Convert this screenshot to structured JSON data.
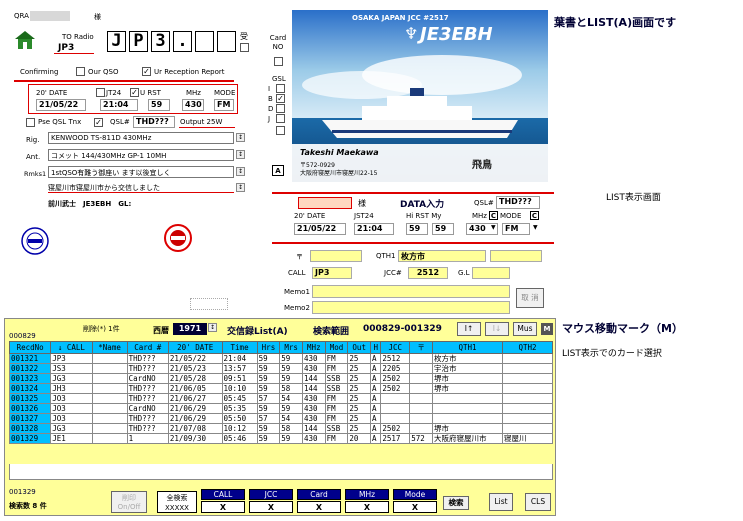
{
  "card": {
    "qra_label": "QRA",
    "qra_value": "",
    "sama": "様",
    "to_radio": "TO Radio",
    "to_call": "JP3",
    "call_chars": [
      "J",
      "P",
      "3",
      ".",
      "",
      ""
    ],
    "uke": "受",
    "card_no_label": "Card NO",
    "confirming": "Confirming",
    "our_qso": "Our QSO",
    "ur_reception": "Ur Reception Report",
    "headers": [
      "20' DATE",
      "JT24",
      "U RST",
      "MHz",
      "MODE"
    ],
    "date": "21/05/22",
    "time": "21:04",
    "rst": "59",
    "mhz": "430",
    "mode": "FM",
    "pse_qsl": "Pse QSL Tnx",
    "qsl_hash": "QSL#",
    "qsl_value": "THD???",
    "output": "Output 25W",
    "rig_label": "Rig.",
    "rig_value": "KENWOOD TS-811D 430MHz",
    "ant_label": "Ant.",
    "ant_value": "コメット 144/430MHz GP-1 10MH",
    "rmks_label": "Rmks1",
    "rmks_value": "1stQSO有難う御座い ます以後宜しく",
    "remark2": "寝屋川市寝屋川市から交信しました",
    "signature": "前川武士　JE3EBH　GL:",
    "gsl_label": "GSL",
    "gsl_options": [
      "I",
      "B",
      "D",
      "J"
    ],
    "gsl_checked": [
      false,
      true,
      false,
      false
    ],
    "a_box": "A"
  },
  "qsl_image": {
    "top_text": "OSAKA JAPAN  JCC #2517",
    "callsign": "JE3EBH",
    "name": "Takeshi Maekawa",
    "addr1": "〒572-0929",
    "addr2": "大阪府寝屋川市寝屋川22-15",
    "ship_name": "飛鳥"
  },
  "annotations": {
    "title1": "葉書とLIST(A)画面です",
    "list_view": "LIST表示画面",
    "mouse_mark": "マウス移動マーク（M）",
    "card_select": "LIST表示でのカード選択"
  },
  "data_entry": {
    "sama": "様",
    "title": "DATA入力",
    "qsl_label": "QSL#",
    "qsl_value": "THD???",
    "headers": [
      "20' DATE",
      "JST24",
      "Hi RST My",
      "MHz",
      "MODE"
    ],
    "date": "21/05/22",
    "time": "21:04",
    "rst": "59",
    "rst_my": "59",
    "mhz": "430",
    "mode": "FM",
    "c_label": "C",
    "zip_label": "〒",
    "qth_label": "QTH1",
    "qth_value": "枚方市",
    "call_label": "CALL",
    "call_value": "JP3",
    "jcc_label": "JCC#",
    "jcc_value": "2512",
    "gl_label": "G.L",
    "memo1_label": "Memo1",
    "memo2_label": "Memo2",
    "delete_label": "取 消"
  },
  "list": {
    "count_top": "000829",
    "deleted": "削除(*) 1件",
    "era": "西暦",
    "year": "1971",
    "title": "交信録List(A)",
    "range_label": "検索範囲",
    "range_value": "000829-001329",
    "btn_up": "I↑",
    "btn_down": "I↓",
    "btn_mus": "Mus",
    "btn_m": "M",
    "columns": [
      "RecdNo",
      "↓ CALL",
      "*Name",
      "Card #",
      "20' DATE",
      "Time",
      "Hrs",
      "Mrs",
      "MHz",
      "Mod",
      "Out",
      "H",
      "JCC",
      "〒",
      "QTH1",
      "QTH2"
    ],
    "rows": [
      [
        "001321",
        "JP3",
        "",
        "THD???",
        "21/05/22",
        "21:04",
        "59",
        "59",
        "430",
        "FM",
        "25",
        "A",
        "2512",
        "",
        "枚方市",
        ""
      ],
      [
        "001322",
        "JS3",
        "",
        "THD???",
        "21/05/23",
        "13:57",
        "59",
        "59",
        "430",
        "FM",
        "25",
        "A",
        "2205",
        "",
        "宇治市",
        ""
      ],
      [
        "001323",
        "JG3",
        "",
        "CardNO",
        "21/05/28",
        "09:51",
        "59",
        "59",
        "144",
        "SSB",
        "25",
        "A",
        "2502",
        "",
        "堺市",
        ""
      ],
      [
        "001324",
        "JH3",
        "",
        "THD???",
        "21/06/05",
        "10:10",
        "59",
        "58",
        "144",
        "SSB",
        "25",
        "A",
        "2502",
        "",
        "堺市",
        ""
      ],
      [
        "001325",
        "JO3",
        "",
        "THD???",
        "21/06/27",
        "05:45",
        "57",
        "54",
        "430",
        "FM",
        "25",
        "A",
        "",
        "",
        "",
        ""
      ],
      [
        "001326",
        "JO3",
        "",
        "CardNO",
        "21/06/29",
        "05:35",
        "59",
        "59",
        "430",
        "FM",
        "25",
        "A",
        "",
        "",
        "",
        ""
      ],
      [
        "001327",
        "JO3",
        "",
        "THD???",
        "21/06/29",
        "05:50",
        "57",
        "54",
        "430",
        "FM",
        "25",
        "A",
        "",
        "",
        "",
        ""
      ],
      [
        "001328",
        "JG3",
        "",
        "THD???",
        "21/07/08",
        "10:12",
        "59",
        "58",
        "144",
        "SSB",
        "25",
        "A",
        "2502",
        "",
        "堺市",
        ""
      ],
      [
        "001329",
        "JE1",
        "",
        "1",
        "21/09/30",
        "05:46",
        "59",
        "59",
        "430",
        "FM",
        "20",
        "A",
        "2517",
        "572",
        "大阪府寝屋川市",
        "寝屋川"
      ]
    ],
    "total_bottom": "001329",
    "search_count": "検索数 8 件",
    "delete_btn": "削印 On/Off",
    "all_search": "全検索 XXXXX",
    "filters": [
      {
        "label": "CALL",
        "value": "X"
      },
      {
        "label": "JCC",
        "value": "X"
      },
      {
        "label": "Card",
        "value": "X"
      },
      {
        "label": "MHz",
        "value": "X"
      },
      {
        "label": "Mode",
        "value": "X"
      }
    ],
    "search_btn": "検索",
    "list_btn": "List",
    "cls_btn": "CLS"
  }
}
